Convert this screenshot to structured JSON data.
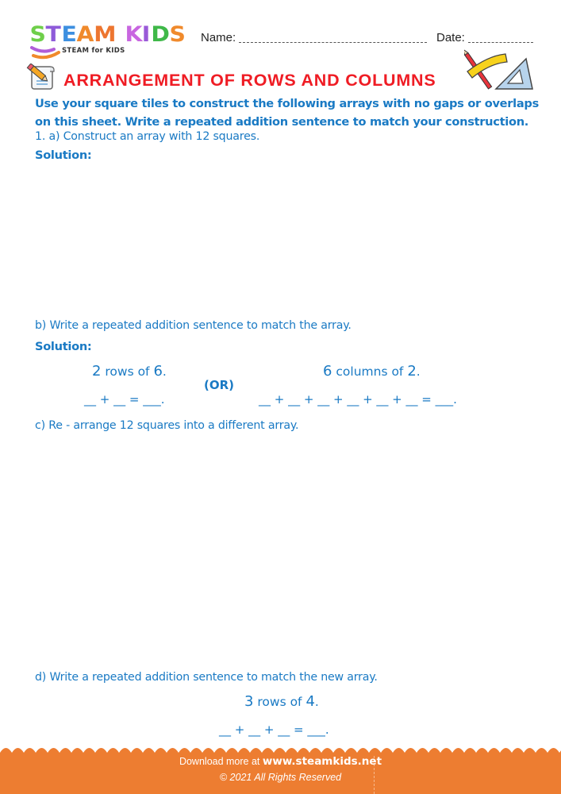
{
  "brand": {
    "logo_letters": [
      {
        "ch": "S",
        "color": "#6fcf4a"
      },
      {
        "ch": "T",
        "color": "#8e5bd9"
      },
      {
        "ch": "E",
        "color": "#3d8fe0"
      },
      {
        "ch": "A",
        "color": "#f08a2c"
      },
      {
        "ch": "M",
        "color": "#ed7630"
      },
      {
        "ch": " ",
        "color": "#ffffff"
      },
      {
        "ch": "K",
        "color": "#c866e0"
      },
      {
        "ch": "I",
        "color": "#9a5ad8"
      },
      {
        "ch": "D",
        "color": "#3fb849"
      },
      {
        "ch": "S",
        "color": "#f08a2c"
      }
    ],
    "tagline": "STEAM for KIDS"
  },
  "header": {
    "name_label": "Name:",
    "date_label": "Date:",
    "title": "ARRANGEMENT OF ROWS AND COLUMNS",
    "title_icon": "pencil-paper-icon",
    "tools_icon": "ruler-pencil-setsquare-icon"
  },
  "colors": {
    "title_red": "#ef1c24",
    "text_blue": "#1a7ac4",
    "footer_orange": "#ed7d31"
  },
  "instructions": "Use your square tiles to construct the following arrays with no gaps or overlaps on this sheet. Write a repeated addition sentence to match your construction.",
  "questions": {
    "a": {
      "label": "1.  a)  Construct an array with 12 squares.",
      "solution_label": "Solution:"
    },
    "b": {
      "label": "b)  Write a repeated addition sentence to match the array.",
      "solution_label": "Solution:",
      "left": {
        "count": "2",
        "unit": " rows of ",
        "size": "6",
        "end": ".",
        "sentence": "__ + __ = ___."
      },
      "or_label": "(OR)",
      "right": {
        "count": "6",
        "unit": " columns of ",
        "size": "2",
        "end": ".",
        "sentence": "__ + __ + __ + __ + __ + __ = ___."
      }
    },
    "c": {
      "label": "c)  Re - arrange 12 squares into a different array."
    },
    "d": {
      "label": "d)  Write a repeated addition sentence to match the new array.",
      "array": {
        "count": "3",
        "unit": " rows of ",
        "size": "4",
        "end": ".",
        "sentence": "__ + __ + __ = ___."
      }
    }
  },
  "footer": {
    "download_prefix": "Download more at ",
    "url": "www.steamkids.net",
    "copyright": "©  2021 All Rights Reserved"
  }
}
